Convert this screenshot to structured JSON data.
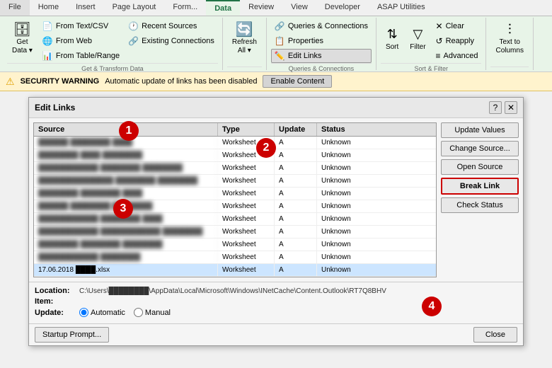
{
  "ribbon": {
    "tabs": [
      "File",
      "Home",
      "Insert",
      "Page Layout",
      "Formulas",
      "Data",
      "Review",
      "View",
      "Developer",
      "ASAP Utilities"
    ],
    "active_tab": "Data",
    "groups": {
      "get_transform": {
        "label": "Get & Transform Data",
        "buttons": [
          {
            "label": "Get\nData",
            "icon": "🗄",
            "dropdown": true
          },
          {
            "label": "From Text/CSV",
            "icon": "📄"
          },
          {
            "label": "From Web",
            "icon": "🌐"
          },
          {
            "label": "From Table/Range",
            "icon": "📊"
          },
          {
            "label": "Recent Sources",
            "icon": "🕐"
          },
          {
            "label": "Existing Connections",
            "icon": "🔗"
          }
        ]
      },
      "queries": {
        "label": "Queries & Connections",
        "buttons": [
          {
            "label": "Queries & Connections",
            "icon": "🔗"
          },
          {
            "label": "Properties",
            "icon": "📋"
          },
          {
            "label": "Edit Links",
            "icon": "✏️"
          }
        ]
      },
      "sort_filter": {
        "label": "Sort & Filter",
        "buttons": [
          "Sort",
          "Filter",
          "Clear",
          "Reapply",
          "Advanced"
        ]
      }
    }
  },
  "security_bar": {
    "icon": "⚠",
    "label": "SECURITY WARNING",
    "message": "Automatic update of links has been disabled",
    "button": "Enable Content"
  },
  "dialog": {
    "title": "Edit Links",
    "help_icon": "?",
    "close_icon": "✕",
    "table": {
      "headers": [
        "Source",
        "Type",
        "Update",
        "Status"
      ],
      "rows": [
        {
          "source": "██████ ████████ ████████",
          "type": "Worksheet",
          "update": "A",
          "status": "Unknown",
          "blurred": true
        },
        {
          "source": "██████ ████████ ████████",
          "type": "Worksheet",
          "update": "A",
          "status": "Unknown",
          "blurred": true
        },
        {
          "source": "████████████ ████████ ████████",
          "type": "Worksheet",
          "update": "A",
          "status": "Unknown",
          "blurred": true
        },
        {
          "source": "███████████████ ████████ ████████",
          "type": "Worksheet",
          "update": "A",
          "status": "Unknown",
          "blurred": true
        },
        {
          "source": "████████ ████████ ████",
          "type": "Worksheet",
          "update": "A",
          "status": "Unknown",
          "blurred": true
        },
        {
          "source": "██████ ████████ ████████",
          "type": "Worksheet",
          "update": "A",
          "status": "Unknown",
          "blurred": true
        },
        {
          "source": "████████████ ████████ ████",
          "type": "Worksheet",
          "update": "A",
          "status": "Unknown",
          "blurred": true
        },
        {
          "source": "████████████ ████████████ ████████",
          "type": "Worksheet",
          "update": "A",
          "status": "Unknown",
          "blurred": true
        },
        {
          "source": "████████ ████████ ████████",
          "type": "Worksheet",
          "update": "A",
          "status": "Unknown",
          "blurred": true
        },
        {
          "source": "████████████ ████████",
          "type": "Worksheet",
          "update": "A",
          "status": "Unknown",
          "blurred": true
        },
        {
          "source": "17.06.2018 ████.xlsx",
          "type": "Worksheet",
          "update": "A",
          "status": "Unknown",
          "blurred": false,
          "selected": true
        }
      ]
    },
    "buttons": [
      {
        "label": "Update Values",
        "id": "update-values"
      },
      {
        "label": "Change Source...",
        "id": "change-source"
      },
      {
        "label": "Open Source",
        "id": "open-source"
      },
      {
        "label": "Break Link",
        "id": "break-link",
        "highlighted": true
      },
      {
        "label": "Check Status",
        "id": "check-status"
      }
    ],
    "footer": {
      "location_label": "Location:",
      "location_value": "C:\\Users\\████████\\AppData\\Local\\Microsoft\\Windows\\INetCache\\Content.Outlook\\RT7Q8BHV",
      "item_label": "Item:",
      "item_value": "",
      "update_label": "Update:",
      "update_options": [
        {
          "label": "Automatic",
          "value": "automatic",
          "checked": true
        },
        {
          "label": "Manual",
          "value": "manual",
          "checked": false
        }
      ]
    },
    "startup_btn": "Startup Prompt...",
    "close_btn": "Close"
  },
  "annotations": [
    {
      "num": "1",
      "class": "annotation-1"
    },
    {
      "num": "2",
      "class": "annotation-2"
    },
    {
      "num": "3",
      "class": "annotation-3"
    },
    {
      "num": "4",
      "class": "annotation-4"
    }
  ]
}
